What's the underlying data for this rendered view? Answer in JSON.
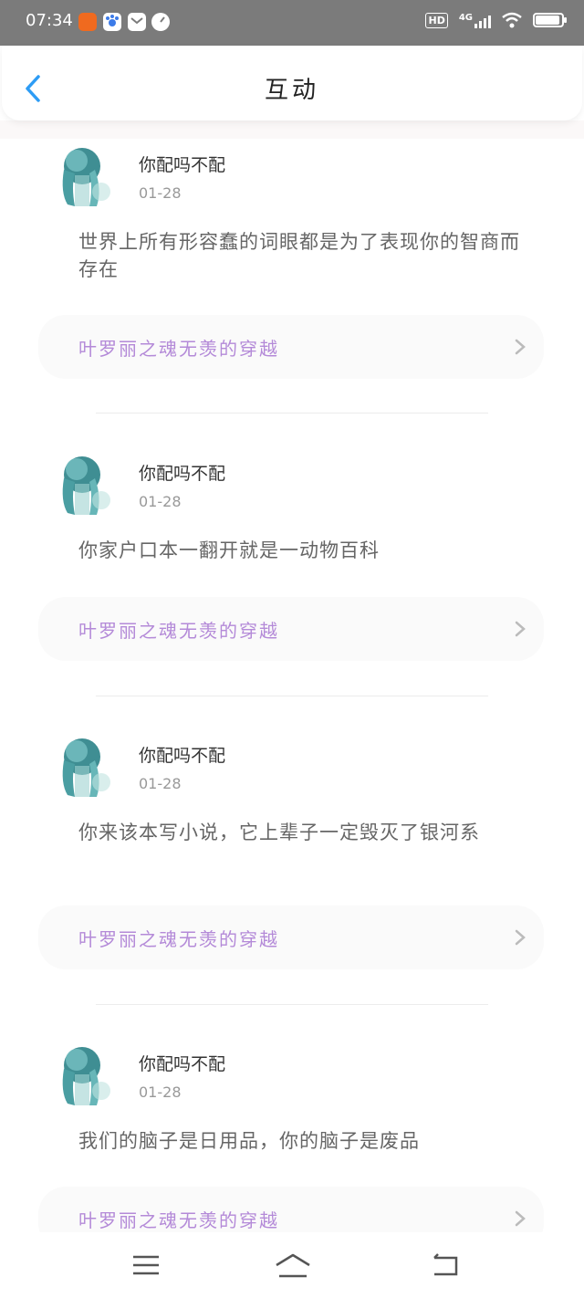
{
  "status_bar": {
    "time": "07:34",
    "network": "4G",
    "hd": "HD",
    "app_icons": [
      {
        "name": "taobao-icon",
        "color": "#f06a1f"
      },
      {
        "name": "baidu-icon",
        "color": "#3c7be8"
      },
      {
        "name": "mail-icon",
        "color": "#ffffff"
      },
      {
        "name": "gauge-icon",
        "color": "#ffffff"
      }
    ]
  },
  "header": {
    "title": "互动"
  },
  "posts": [
    {
      "username": "你配吗不配",
      "date": "01-28",
      "text": "世界上所有形容蠢的词眼都是为了表现你的智商而存在",
      "book": "叶罗丽之魂无羡的穿越"
    },
    {
      "username": "你配吗不配",
      "date": "01-28",
      "text": "你家户口本一翻开就是一动物百科",
      "book": "叶罗丽之魂无羡的穿越"
    },
    {
      "username": "你配吗不配",
      "date": "01-28",
      "text": "你来该本写小说，它上辈子一定毁灭了银河系",
      "book": "叶罗丽之魂无羡的穿越"
    },
    {
      "username": "你配吗不配",
      "date": "01-28",
      "text": "我们的脑子是日用品，你的脑子是废品",
      "book": "叶罗丽之魂无羡的穿越"
    }
  ],
  "colors": {
    "accent": "#2d9cf5",
    "book_title": "#b48ad8",
    "status_bar": "#7b7b7b"
  }
}
